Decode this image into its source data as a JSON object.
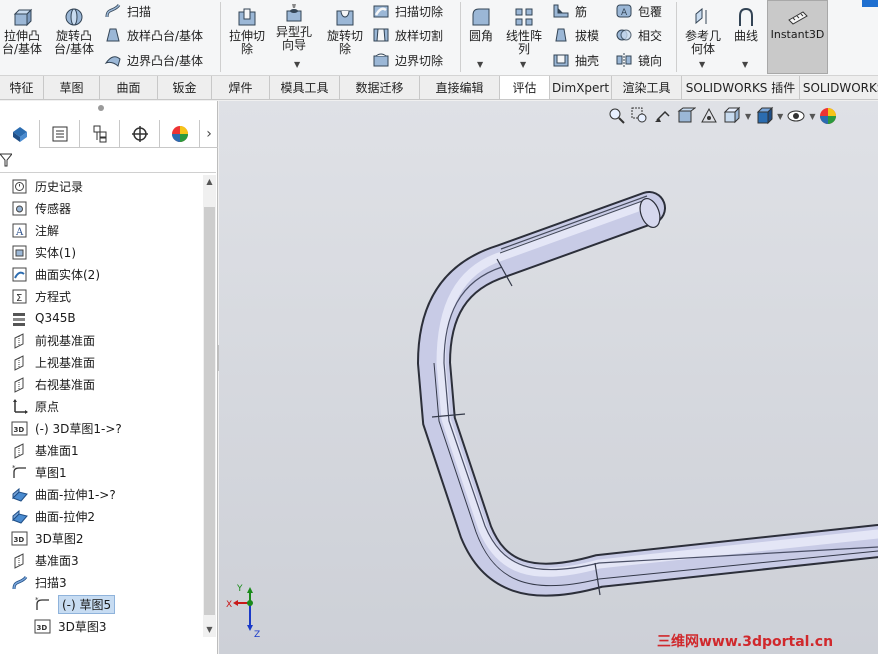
{
  "ribbon": {
    "extrude_boss": "拉伸凸\n台/基体",
    "revolve_boss": "旋转凸\n台/基体",
    "sweep": "扫描",
    "loft_boss": "放样凸台/基体",
    "boundary_boss": "边界凸台/基体",
    "extrude_cut": "拉伸切\n除",
    "hole_wizard": "异型孔\n向导",
    "revolve_cut": "旋转切\n除",
    "sweep_cut": "扫描切除",
    "loft_cut": "放样切割",
    "boundary_cut": "边界切除",
    "fillet": "圆角",
    "linear_pattern": "线性阵\n列",
    "rib": "筋",
    "draft": "拔模",
    "shell": "抽壳",
    "wrap": "包覆",
    "intersect": "相交",
    "mirror": "镜向",
    "ref_geometry": "参考几\n何体",
    "curves": "曲线",
    "instant3d": "Instant3D"
  },
  "tabs": [
    "特征",
    "草图",
    "曲面",
    "钣金",
    "焊件",
    "模具工具",
    "数据迁移",
    "直接编辑",
    "评估",
    "DimXpert",
    "渲染工具",
    "SOLIDWORKS 插件",
    "SOLIDWORKS MBD"
  ],
  "active_tab_index": 8,
  "tree": [
    {
      "label": "历史记录",
      "icon": "history-icon"
    },
    {
      "label": "传感器",
      "icon": "sensor-icon"
    },
    {
      "label": "注解",
      "icon": "annotation-icon"
    },
    {
      "label": "实体(1)",
      "icon": "solid-bodies-icon"
    },
    {
      "label": "曲面实体(2)",
      "icon": "surface-bodies-icon"
    },
    {
      "label": "方程式",
      "icon": "equations-icon"
    },
    {
      "label": "Q345B",
      "icon": "material-icon"
    },
    {
      "label": "前视基准面",
      "icon": "plane-icon"
    },
    {
      "label": "上视基准面",
      "icon": "plane-icon"
    },
    {
      "label": "右视基准面",
      "icon": "plane-icon"
    },
    {
      "label": "原点",
      "icon": "origin-icon"
    },
    {
      "label": "(-) 3D草图1->?",
      "icon": "sketch3d-icon"
    },
    {
      "label": "基准面1",
      "icon": "plane-icon"
    },
    {
      "label": "草图1",
      "icon": "sketch-icon"
    },
    {
      "label": "曲面-拉伸1->?",
      "icon": "surface-extrude-icon"
    },
    {
      "label": "曲面-拉伸2",
      "icon": "surface-extrude-icon"
    },
    {
      "label": "3D草图2",
      "icon": "sketch3d-icon"
    },
    {
      "label": "基准面3",
      "icon": "plane-icon"
    },
    {
      "label": "扫描3",
      "icon": "sweep-icon"
    },
    {
      "label": "(-) 草图5",
      "icon": "sketch-icon",
      "selected": true
    },
    {
      "label": "3D草图3",
      "icon": "sketch3d-icon"
    }
  ],
  "watermark": "三维网www.3dportal.cn",
  "triad": {
    "x": "X",
    "y": "Y",
    "z": "Z"
  }
}
